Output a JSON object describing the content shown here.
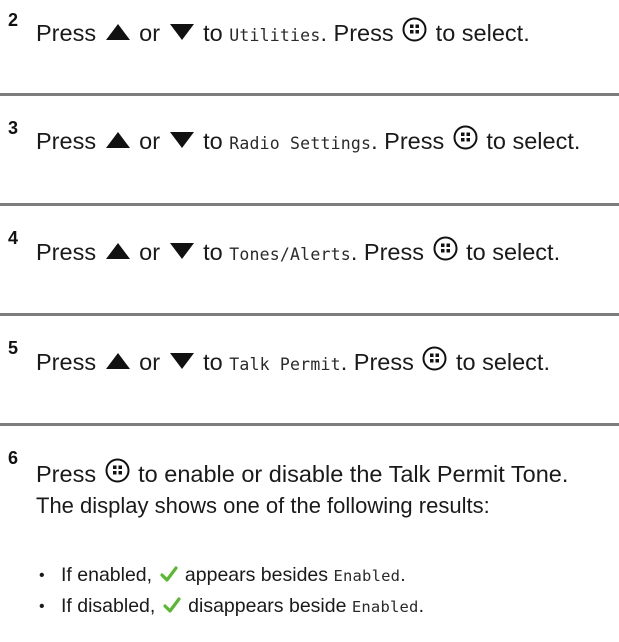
{
  "steps": [
    {
      "number": "2",
      "press": "Press",
      "or": "or",
      "to": "to",
      "menu_item": "Utilities",
      "after_item": ". Press",
      "tail": "to select."
    },
    {
      "number": "3",
      "press": "Press",
      "or": "or",
      "to": "to",
      "menu_item": "Radio Settings",
      "after_item": ". Press",
      "tail": "to select."
    },
    {
      "number": "4",
      "press": "Press",
      "or": "or",
      "to": "to",
      "menu_item": "Tones/Alerts",
      "after_item": ". Press",
      "tail": "to select."
    },
    {
      "number": "5",
      "press": "Press",
      "or": "or",
      "to": "to",
      "menu_item": "Talk Permit",
      "after_item": ". Press",
      "tail": "to select."
    }
  ],
  "step6": {
    "number": "6",
    "press": "Press",
    "tail": "to enable or disable the Talk Permit Tone.",
    "result_intro": "The display shows one of the following results:",
    "bullets": [
      {
        "prefix": "If enabled,",
        "middle": "appears besides",
        "item": "Enabled",
        "suffix": "."
      },
      {
        "prefix": "If disabled,",
        "middle": "disappears beside",
        "item": "Enabled",
        "suffix": "."
      }
    ],
    "bullet_glyph": "•"
  },
  "icons": {
    "up": "up-arrow-icon",
    "down": "down-arrow-icon",
    "menu_ok": "menu-ok-button-icon",
    "check": "checkmark-icon"
  },
  "colors": {
    "separator": "#7d7d7d",
    "check": "#5bb833",
    "text": "#1a1a1a"
  }
}
